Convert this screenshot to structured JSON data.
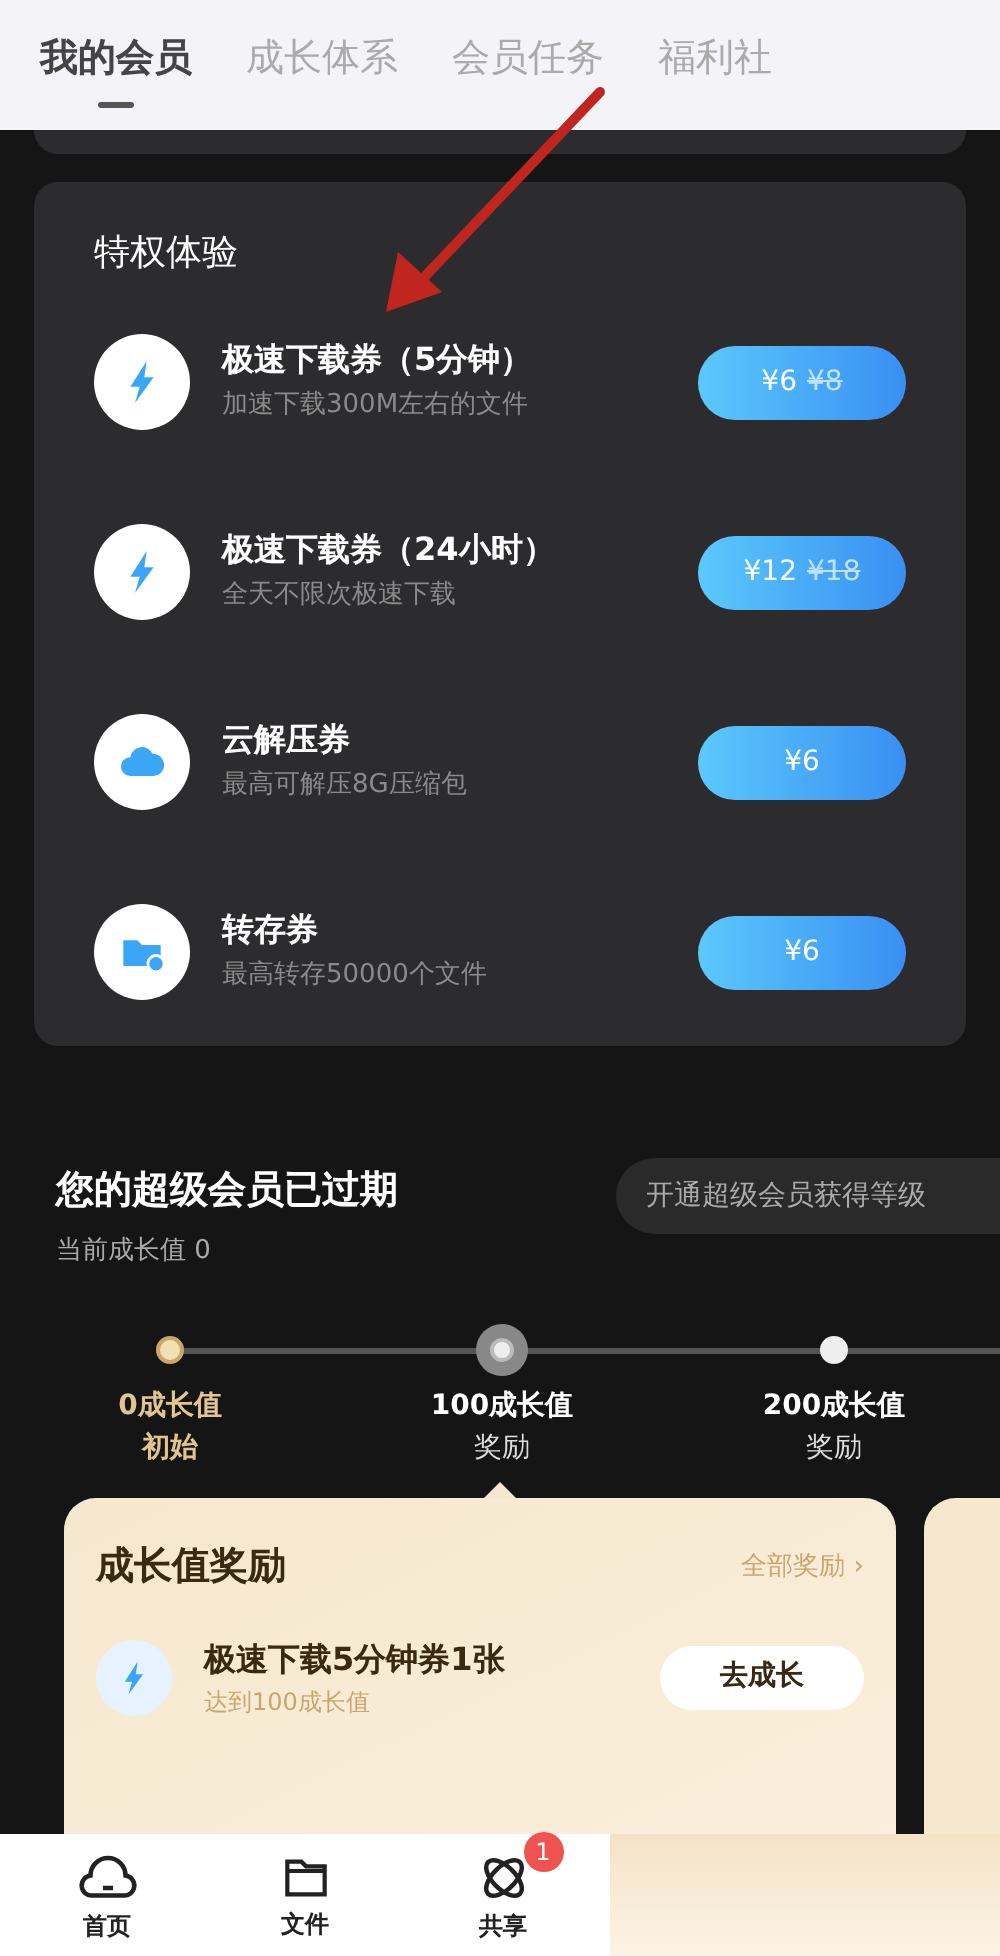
{
  "tabs": [
    {
      "label": "我的会员",
      "selected": true
    },
    {
      "label": "成长体系",
      "selected": false
    },
    {
      "label": "会员任务",
      "selected": false
    },
    {
      "label": "福利社",
      "selected": false
    }
  ],
  "privileges": {
    "title": "特权体验",
    "items": [
      {
        "kind": "bolt",
        "name": "极速下载券（5分钟）",
        "desc": "加速下载300M左右的文件",
        "price": "¥6",
        "original_price": "¥8"
      },
      {
        "kind": "bolt",
        "name": "极速下载券（24小时）",
        "desc": "全天不限次极速下载",
        "price": "¥12",
        "original_price": "¥18"
      },
      {
        "kind": "cloud",
        "name": "云解压券",
        "desc": "最高可解压8G压缩包",
        "price": "¥6"
      },
      {
        "kind": "folder",
        "name": "转存券",
        "desc": "最高转存50000个文件",
        "price": "¥6"
      }
    ]
  },
  "growth": {
    "title": "您的超级会员已过期",
    "current": "当前成长值 0",
    "cta": "开通超级会员获得等级",
    "milestones": [
      {
        "kind": "reached",
        "value": "0成长值",
        "label": "初始"
      },
      {
        "kind": "current",
        "value": "100成长值",
        "label": "奖励"
      },
      {
        "kind": "upcoming",
        "value": "200成长值",
        "label": "奖励"
      }
    ]
  },
  "rewards": {
    "title": "成长值奖励",
    "link": "全部奖励 ›",
    "item": {
      "name": "极速下载5分钟券1张",
      "desc": "达到100成长值",
      "button": "去成长"
    }
  },
  "nav": [
    {
      "kind": "home",
      "label": "首页"
    },
    {
      "kind": "files",
      "label": "文件"
    },
    {
      "kind": "share",
      "label": "共享",
      "badge": "1"
    }
  ]
}
